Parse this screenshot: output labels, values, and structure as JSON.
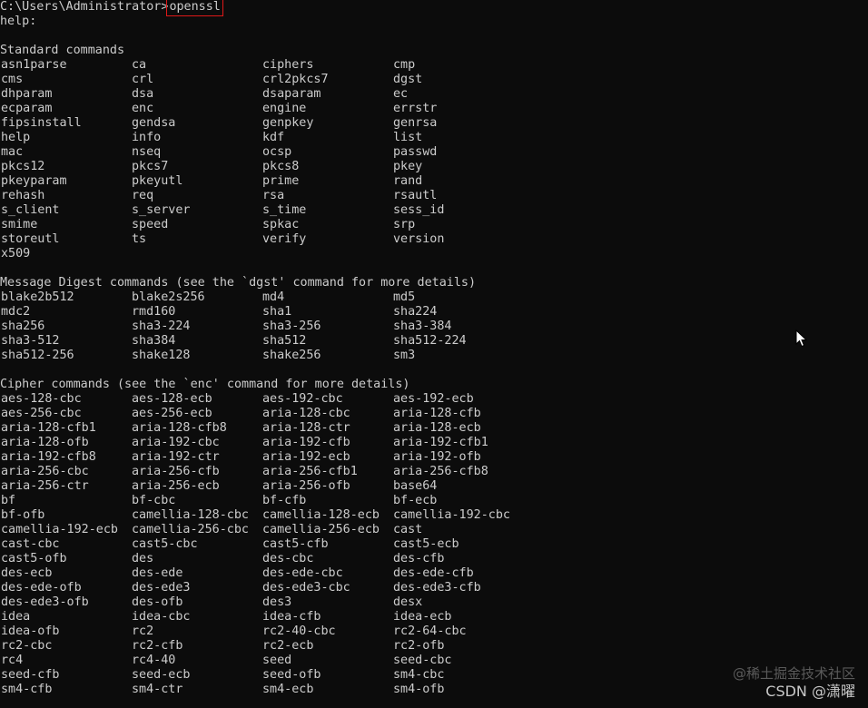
{
  "terminal": {
    "prompt": "C:\\Users\\Administrator>",
    "command": "openssl",
    "help_line": "help:",
    "sections": [
      {
        "heading": "Standard commands",
        "rows": [
          [
            "asn1parse",
            "ca",
            "ciphers",
            "cmp"
          ],
          [
            "cms",
            "crl",
            "crl2pkcs7",
            "dgst"
          ],
          [
            "dhparam",
            "dsa",
            "dsaparam",
            "ec"
          ],
          [
            "ecparam",
            "enc",
            "engine",
            "errstr"
          ],
          [
            "fipsinstall",
            "gendsa",
            "genpkey",
            "genrsa"
          ],
          [
            "help",
            "info",
            "kdf",
            "list"
          ],
          [
            "mac",
            "nseq",
            "ocsp",
            "passwd"
          ],
          [
            "pkcs12",
            "pkcs7",
            "pkcs8",
            "pkey"
          ],
          [
            "pkeyparam",
            "pkeyutl",
            "prime",
            "rand"
          ],
          [
            "rehash",
            "req",
            "rsa",
            "rsautl"
          ],
          [
            "s_client",
            "s_server",
            "s_time",
            "sess_id"
          ],
          [
            "smime",
            "speed",
            "spkac",
            "srp"
          ],
          [
            "storeutl",
            "ts",
            "verify",
            "version"
          ],
          [
            "x509"
          ]
        ]
      },
      {
        "heading": "Message Digest commands (see the `dgst' command for more details)",
        "rows": [
          [
            "blake2b512",
            "blake2s256",
            "md4",
            "md5"
          ],
          [
            "mdc2",
            "rmd160",
            "sha1",
            "sha224"
          ],
          [
            "sha256",
            "sha3-224",
            "sha3-256",
            "sha3-384"
          ],
          [
            "sha3-512",
            "sha384",
            "sha512",
            "sha512-224"
          ],
          [
            "sha512-256",
            "shake128",
            "shake256",
            "sm3"
          ]
        ]
      },
      {
        "heading": "Cipher commands (see the `enc' command for more details)",
        "rows": [
          [
            "aes-128-cbc",
            "aes-128-ecb",
            "aes-192-cbc",
            "aes-192-ecb"
          ],
          [
            "aes-256-cbc",
            "aes-256-ecb",
            "aria-128-cbc",
            "aria-128-cfb"
          ],
          [
            "aria-128-cfb1",
            "aria-128-cfb8",
            "aria-128-ctr",
            "aria-128-ecb"
          ],
          [
            "aria-128-ofb",
            "aria-192-cbc",
            "aria-192-cfb",
            "aria-192-cfb1"
          ],
          [
            "aria-192-cfb8",
            "aria-192-ctr",
            "aria-192-ecb",
            "aria-192-ofb"
          ],
          [
            "aria-256-cbc",
            "aria-256-cfb",
            "aria-256-cfb1",
            "aria-256-cfb8"
          ],
          [
            "aria-256-ctr",
            "aria-256-ecb",
            "aria-256-ofb",
            "base64"
          ],
          [
            "bf",
            "bf-cbc",
            "bf-cfb",
            "bf-ecb"
          ],
          [
            "bf-ofb",
            "camellia-128-cbc",
            "camellia-128-ecb",
            "camellia-192-cbc"
          ],
          [
            "camellia-192-ecb",
            "camellia-256-cbc",
            "camellia-256-ecb",
            "cast"
          ],
          [
            "cast-cbc",
            "cast5-cbc",
            "cast5-cfb",
            "cast5-ecb"
          ],
          [
            "cast5-ofb",
            "des",
            "des-cbc",
            "des-cfb"
          ],
          [
            "des-ecb",
            "des-ede",
            "des-ede-cbc",
            "des-ede-cfb"
          ],
          [
            "des-ede-ofb",
            "des-ede3",
            "des-ede3-cbc",
            "des-ede3-cfb"
          ],
          [
            "des-ede3-ofb",
            "des-ofb",
            "des3",
            "desx"
          ],
          [
            "idea",
            "idea-cbc",
            "idea-cfb",
            "idea-ecb"
          ],
          [
            "idea-ofb",
            "rc2",
            "rc2-40-cbc",
            "rc2-64-cbc"
          ],
          [
            "rc2-cbc",
            "rc2-cfb",
            "rc2-ecb",
            "rc2-ofb"
          ],
          [
            "rc4",
            "rc4-40",
            "seed",
            "seed-cbc"
          ],
          [
            "seed-cfb",
            "seed-ecb",
            "seed-ofb",
            "sm4-cbc"
          ],
          [
            "sm4-cfb",
            "sm4-ctr",
            "sm4-ecb",
            "sm4-ofb"
          ]
        ]
      }
    ]
  },
  "watermark": {
    "line1": "@稀土掘金技术社区",
    "line2": "CSDN @潇曜"
  },
  "colors": {
    "background": "#0c0c0c",
    "text": "#cccccc",
    "highlight_box": "#e01818"
  },
  "icons": {
    "mouse_cursor": "arrow-pointer"
  }
}
